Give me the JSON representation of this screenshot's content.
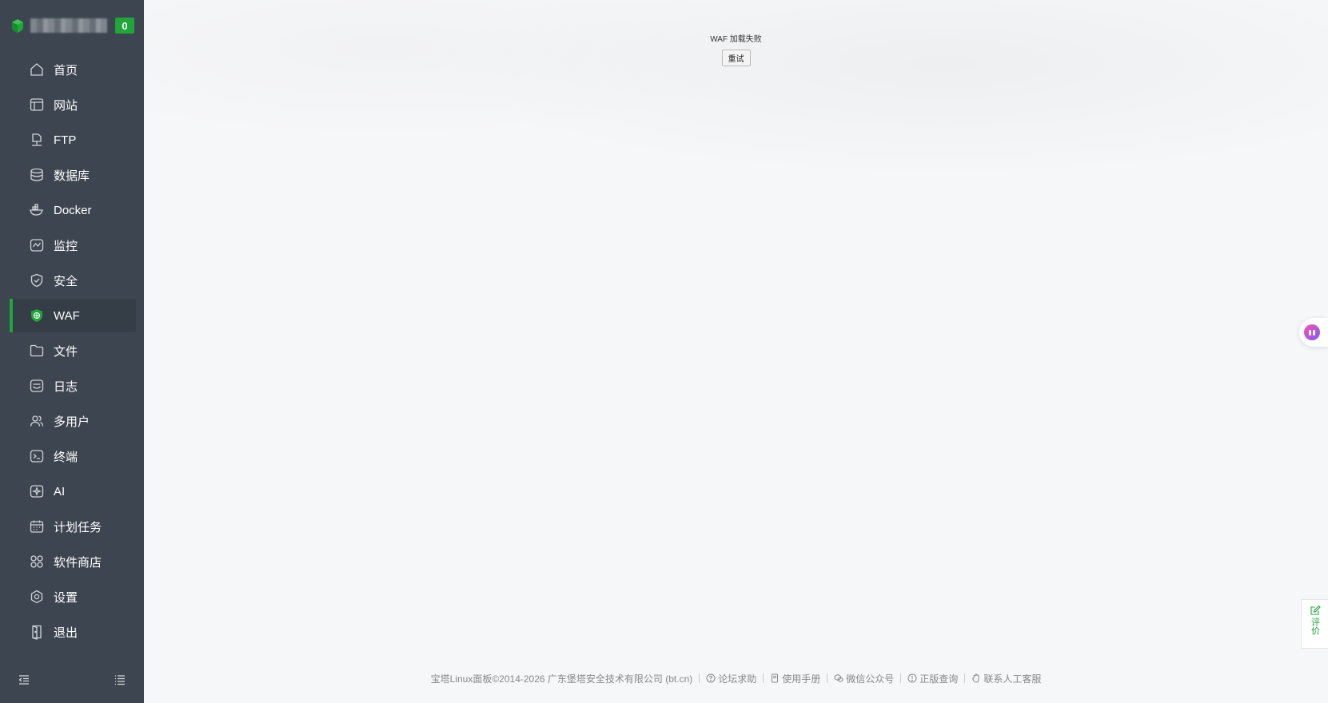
{
  "brand": {
    "badge": "0"
  },
  "sidebar": {
    "items": [
      {
        "label": "首页",
        "icon": "home-icon"
      },
      {
        "label": "网站",
        "icon": "website-icon"
      },
      {
        "label": "FTP",
        "icon": "ftp-icon"
      },
      {
        "label": "数据库",
        "icon": "database-icon"
      },
      {
        "label": "Docker",
        "icon": "docker-icon"
      },
      {
        "label": "监控",
        "icon": "monitor-icon"
      },
      {
        "label": "安全",
        "icon": "shield-icon"
      },
      {
        "label": "WAF",
        "icon": "waf-icon",
        "active": true
      },
      {
        "label": "文件",
        "icon": "folder-icon"
      },
      {
        "label": "日志",
        "icon": "log-icon"
      },
      {
        "label": "多用户",
        "icon": "users-icon"
      },
      {
        "label": "终端",
        "icon": "terminal-icon"
      },
      {
        "label": "AI",
        "icon": "ai-icon"
      },
      {
        "label": "计划任务",
        "icon": "calendar-icon"
      },
      {
        "label": "软件商店",
        "icon": "apps-icon"
      },
      {
        "label": "设置",
        "icon": "settings-icon"
      },
      {
        "label": "退出",
        "icon": "logout-icon"
      }
    ],
    "bottom": {
      "left_icon": "collapse-sidebar-icon",
      "right_icon": "menu-list-icon"
    }
  },
  "main": {
    "error_message": "WAF 加载失败",
    "retry_label": "重试"
  },
  "footer": {
    "copyright": "宝塔Linux面板©2014-2026 广东堡塔安全技术有限公司 (bt.cn)",
    "links": [
      {
        "label": "论坛求助",
        "icon": "help-circle-icon"
      },
      {
        "label": "使用手册",
        "icon": "book-icon"
      },
      {
        "label": "微信公众号",
        "icon": "wechat-icon"
      },
      {
        "label": "正版查询",
        "icon": "info-circle-icon"
      },
      {
        "label": "联系人工客服",
        "icon": "hand-icon"
      }
    ]
  },
  "feedback": {
    "label": "评价"
  },
  "colors": {
    "sidebar_bg": "#3d4650",
    "accent": "#20a53a",
    "main_bg": "#f6f7f8"
  }
}
